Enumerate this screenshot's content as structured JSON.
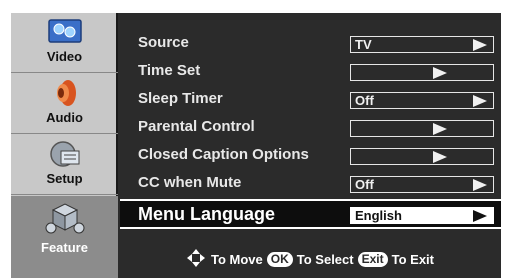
{
  "sidebar": {
    "items": [
      {
        "label": "Video",
        "icon": "video-icon"
      },
      {
        "label": "Audio",
        "icon": "speaker-icon"
      },
      {
        "label": "Setup",
        "icon": "setup-icon"
      },
      {
        "label": "Feature",
        "icon": "feature-icon"
      }
    ]
  },
  "menu": {
    "rows": [
      {
        "label": "Source",
        "value": "TV"
      },
      {
        "label": "Time Set",
        "value": ""
      },
      {
        "label": "Sleep Timer",
        "value": "Off"
      },
      {
        "label": "Parental Control",
        "value": ""
      },
      {
        "label": "Closed Caption Options",
        "value": ""
      },
      {
        "label": "CC when Mute",
        "value": "Off"
      },
      {
        "label": "Menu Language",
        "value": "English"
      }
    ]
  },
  "footer": {
    "move": "To Move",
    "ok_key": "OK",
    "select": "To Select",
    "exit_key": "Exit",
    "exit": "To Exit"
  }
}
